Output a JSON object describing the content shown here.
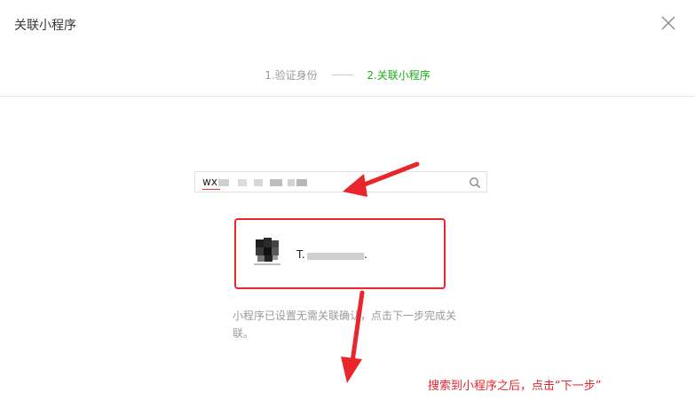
{
  "dialog": {
    "title": "关联小程序",
    "close_icon": "close-icon"
  },
  "steps": [
    {
      "label": "1.验证身份",
      "state": "done"
    },
    {
      "label": "2.关联小程序",
      "state": "active"
    }
  ],
  "search": {
    "value": "wx",
    "icon": "search-icon"
  },
  "result": {
    "name": "T.",
    "suffix": "."
  },
  "hint": "小程序已设置无需关联确认，点击下一步完成关联。",
  "annotation": "搜索到小程序之后，点击“下一步”",
  "colors": {
    "accent_green": "#1aad19",
    "annotation_red": "#e8262b",
    "muted_gray": "#9a9a9a"
  }
}
